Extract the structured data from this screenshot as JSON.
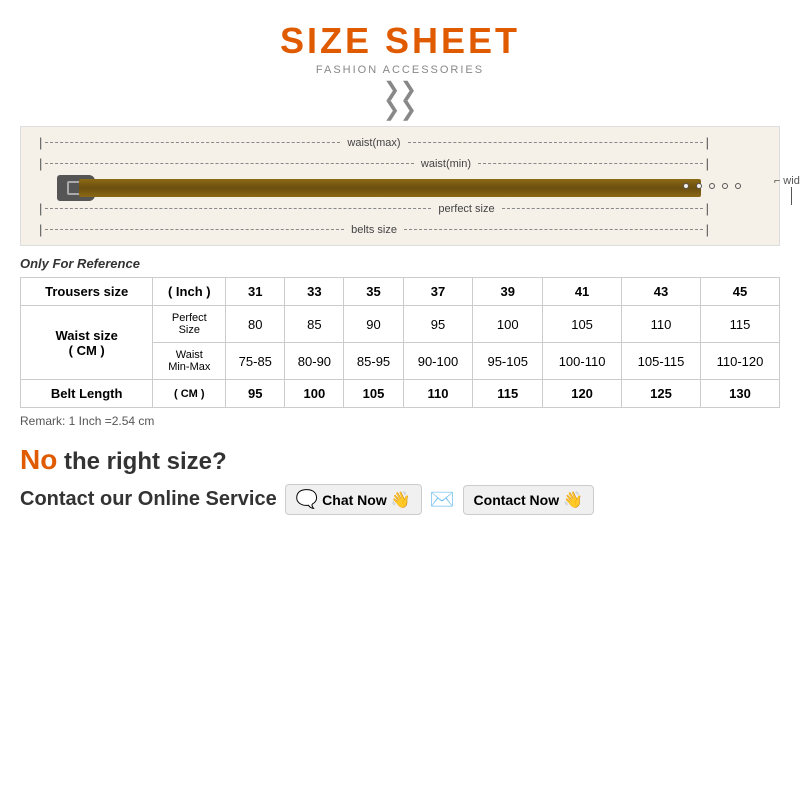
{
  "title": {
    "main": "SIZE SHEET",
    "sub": "FASHION ACCESSORIES"
  },
  "belt_diagram": {
    "rows": [
      {
        "label": "waist(max)",
        "type": "full"
      },
      {
        "label": "waist(min)",
        "type": "medium"
      },
      {
        "label": "perfect size",
        "type": "medium-short"
      },
      {
        "label": "belts size",
        "type": "full"
      }
    ],
    "width_label": "width"
  },
  "reference_note": "Only For Reference",
  "table": {
    "col_header": [
      "Trousers size",
      "( Inch )",
      "31",
      "33",
      "35",
      "37",
      "39",
      "41",
      "43",
      "45"
    ],
    "waist_label": "Waist size\n( CM )",
    "perfect_label": "Perfect\nSize",
    "perfect_values": [
      "80",
      "85",
      "90",
      "95",
      "100",
      "105",
      "110",
      "115"
    ],
    "waist_min_max_label": "Waist\nMin-Max",
    "waist_values": [
      "75-85",
      "80-90",
      "85-95",
      "90-100",
      "95-105",
      "100-110",
      "105-115",
      "110-120"
    ],
    "belt_length_label": "Belt Length",
    "belt_length_unit": "( CM )",
    "belt_length_values": [
      "95",
      "100",
      "105",
      "110",
      "115",
      "120",
      "125",
      "130"
    ]
  },
  "remark": "Remark: 1 Inch =2.54 cm",
  "no_size": {
    "no": "No",
    "rest": " the right size?"
  },
  "contact": {
    "label": "Contact our Online Service",
    "chat_label": "Chat Now",
    "contact_label": "Contact Now"
  }
}
